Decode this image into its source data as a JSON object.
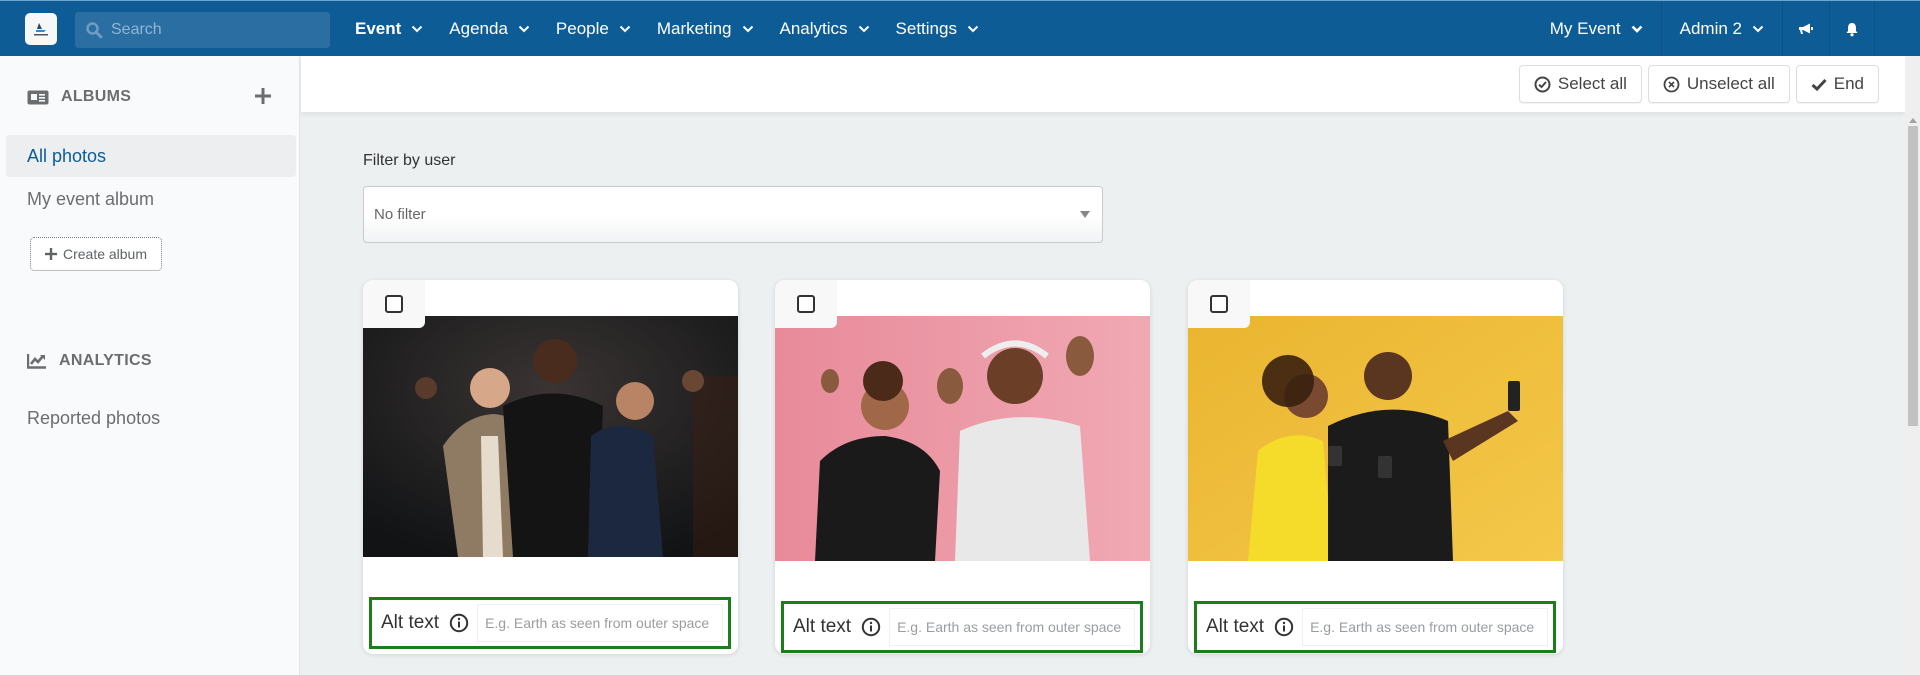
{
  "topbar": {
    "logo_icon": "app-logo-icon",
    "search_placeholder": "Search",
    "nav": [
      {
        "label": "Event",
        "active": true
      },
      {
        "label": "Agenda"
      },
      {
        "label": "People"
      },
      {
        "label": "Marketing"
      },
      {
        "label": "Analytics"
      },
      {
        "label": "Settings"
      }
    ],
    "event_selector": "My Event",
    "user_menu": "Admin 2",
    "icons": [
      "megaphone-icon",
      "bell-icon"
    ]
  },
  "sidebar": {
    "albums_header": "ALBUMS",
    "albums": [
      {
        "label": "All photos",
        "active": true
      },
      {
        "label": "My event album"
      }
    ],
    "create_album_label": "Create album",
    "analytics_header": "ANALYTICS",
    "analytics_items": [
      {
        "label": "Reported photos"
      }
    ]
  },
  "actions": {
    "select_all": "Select all",
    "unselect_all": "Unselect all",
    "end": "End"
  },
  "filter": {
    "label": "Filter by user",
    "selected": "No filter"
  },
  "photos": [
    {
      "description": "Three men cheering against a dark background",
      "checked": false,
      "alt_label": "Alt text",
      "alt_placeholder": "E.g. Earth as seen from outer space",
      "alt_value": ""
    },
    {
      "description": "Woman and man with headphones dancing against a pink background",
      "checked": false,
      "alt_label": "Alt text",
      "alt_placeholder": "E.g. Earth as seen from outer space",
      "alt_value": ""
    },
    {
      "description": "Couple holding coffee cups taking a selfie against a yellow background",
      "checked": false,
      "alt_label": "Alt text",
      "alt_placeholder": "E.g. Earth as seen from outer space",
      "alt_value": ""
    }
  ],
  "colors": {
    "brand": "#0d5c96",
    "focus_outline": "#1a7f1a"
  }
}
